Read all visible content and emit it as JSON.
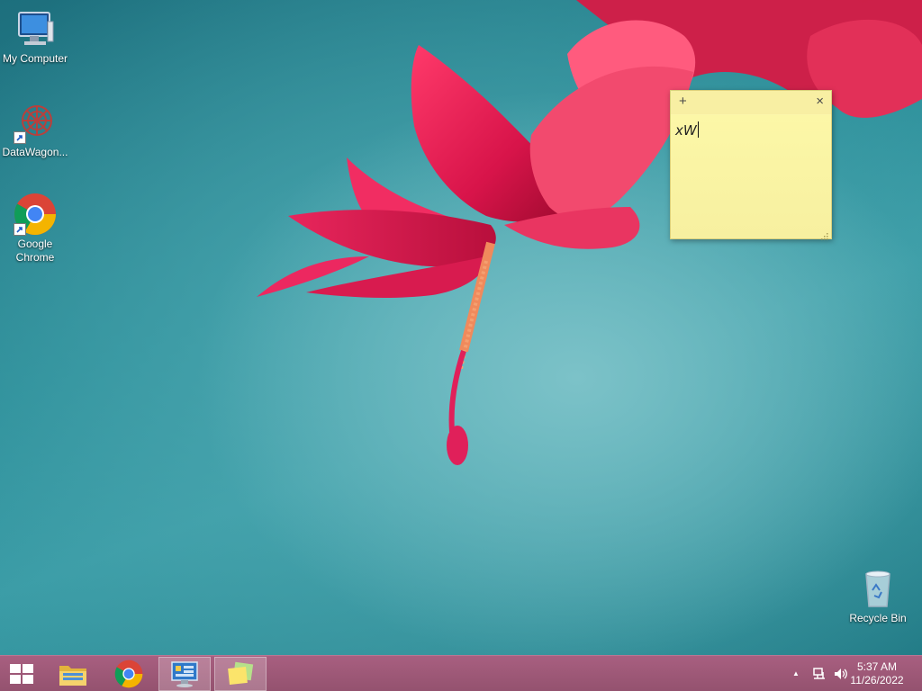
{
  "desktop": {
    "icons": [
      {
        "label": "My Computer"
      },
      {
        "label": "DataWagon..."
      },
      {
        "label": "Google Chrome"
      },
      {
        "label": "Recycle Bin"
      }
    ]
  },
  "sticky_note": {
    "add_glyph": "+",
    "close_glyph": "×",
    "text": "xW",
    "color": "#fdf7b0"
  },
  "taskbar": {
    "color": "#9c5a77",
    "pinned": [
      {
        "icon": "file-explorer-icon"
      },
      {
        "icon": "chrome-icon"
      },
      {
        "icon": "control-panel-icon"
      },
      {
        "icon": "sticky-notes-icon"
      }
    ],
    "tray": {
      "overflow_glyph": "▲",
      "time": "5:37 AM",
      "date": "11/26/2022"
    }
  }
}
